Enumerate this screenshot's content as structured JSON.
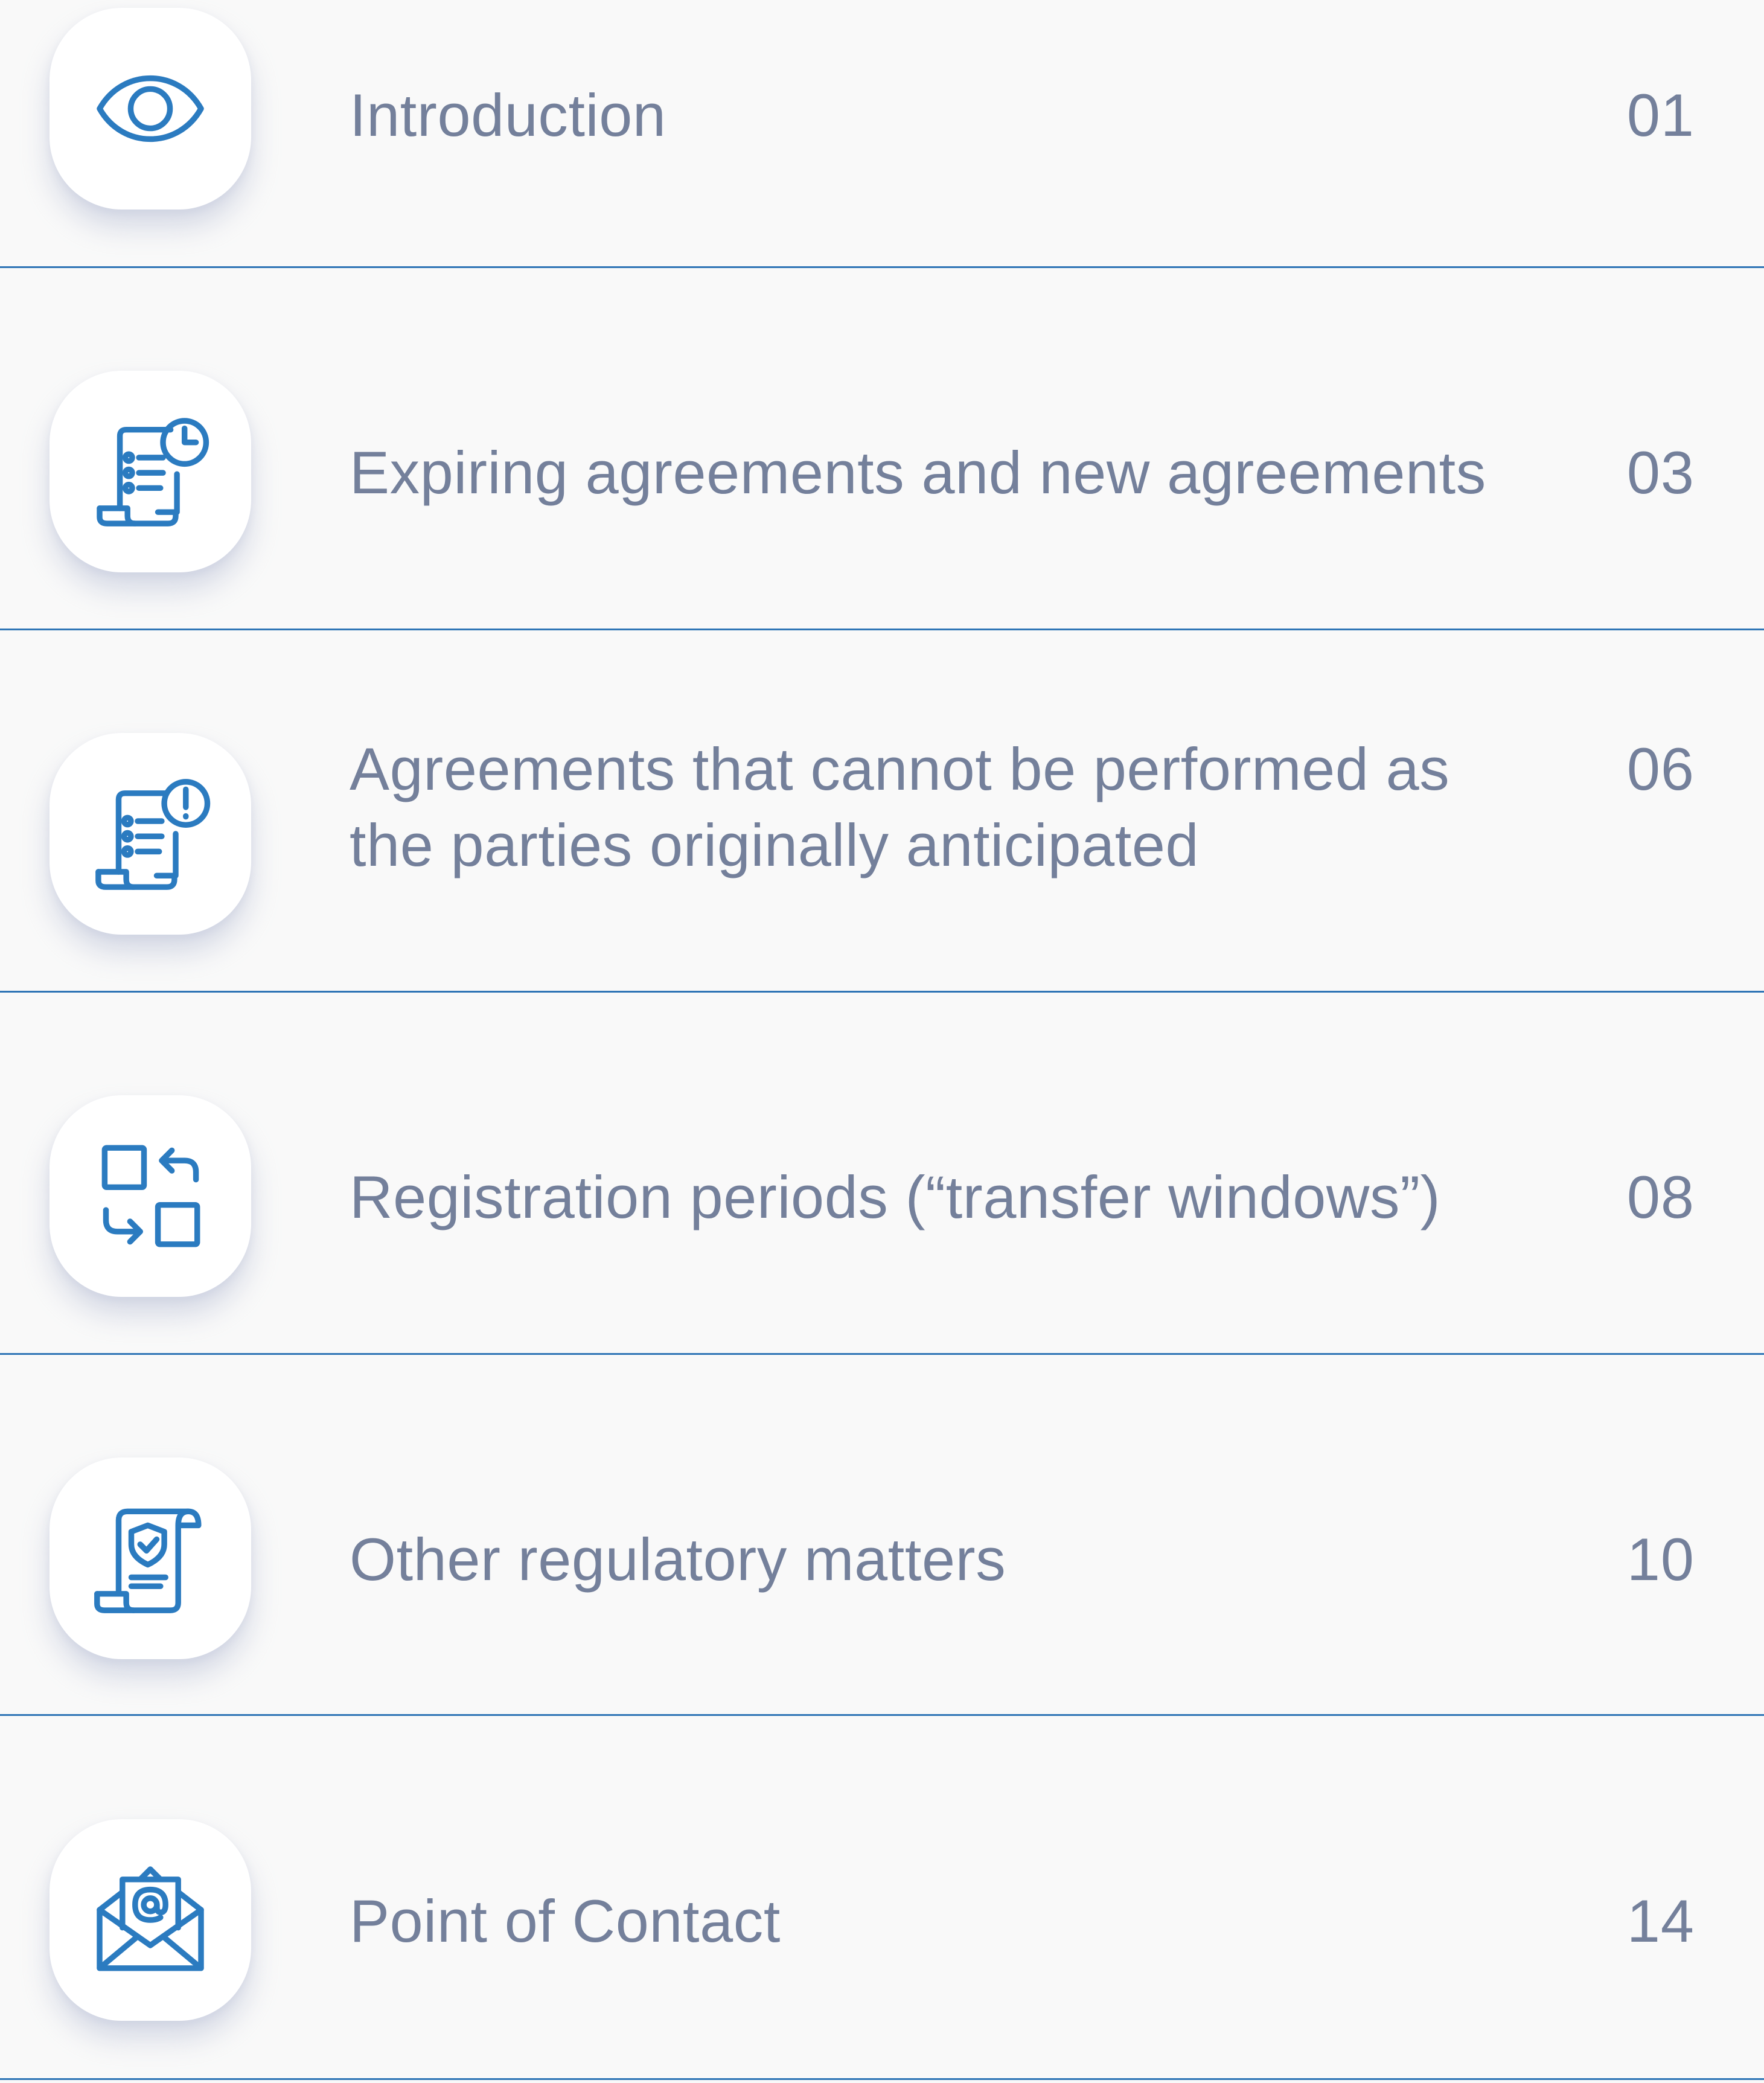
{
  "toc": {
    "items": [
      {
        "title": "Introduction",
        "page": "01",
        "icon": "eye-icon"
      },
      {
        "title": "Expiring agreements and new agreements",
        "page": "03",
        "icon": "document-clock-icon"
      },
      {
        "title_line_1": "Agreements that cannot be performed as",
        "title_line_2": "the parties originally anticipated",
        "page": "06",
        "icon": "document-alert-icon"
      },
      {
        "title": "Registration periods (“transfer windows”)",
        "page": "08",
        "icon": "transfer-squares-icon"
      },
      {
        "title": "Other regulatory matters",
        "page": "10",
        "icon": "shield-document-icon"
      },
      {
        "title": "Point of Contact",
        "page": "14",
        "icon": "email-envelope-icon"
      }
    ]
  },
  "colors": {
    "background": "#f9f9f9",
    "text": "#74809b",
    "accent": "#2b7bc0",
    "divider": "#2f75b6",
    "tile": "#ffffff"
  }
}
